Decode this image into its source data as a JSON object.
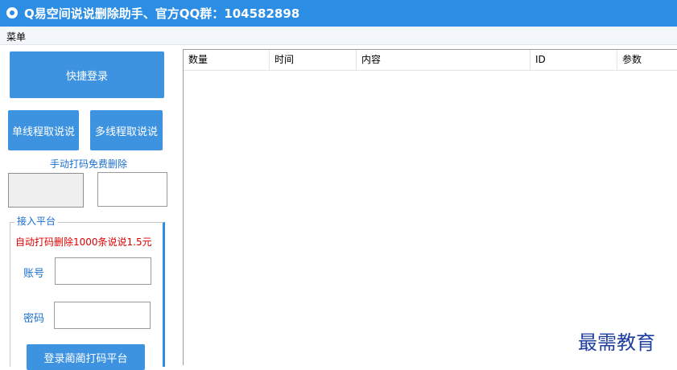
{
  "window": {
    "title": "Q易空间说说删除助手、官方QQ群：104582898"
  },
  "menu": {
    "items": [
      "菜单"
    ]
  },
  "left_panel": {
    "quick_login_label": "快捷登录",
    "single_thread_label": "单线程取说说",
    "multi_thread_label": "多线程取说说",
    "manual_captcha_label": "手动打码免费删除",
    "captcha_input_value": ""
  },
  "platform": {
    "legend": "接入平台",
    "price_text": "自动打码删除1000条说说1.5元",
    "account_label": "账号",
    "account_value": "",
    "password_label": "密码",
    "password_value": "",
    "login_button_label": "登录蔺蔺打码平台"
  },
  "table": {
    "columns": [
      "数量",
      "时间",
      "内容",
      "ID",
      "参数"
    ],
    "rows": []
  },
  "watermark": "最需教育",
  "colors": {
    "titlebar": "#2b8ee4",
    "button": "#3e93e0",
    "label_blue": "#1a6fd0",
    "price_red": "#e00000"
  }
}
